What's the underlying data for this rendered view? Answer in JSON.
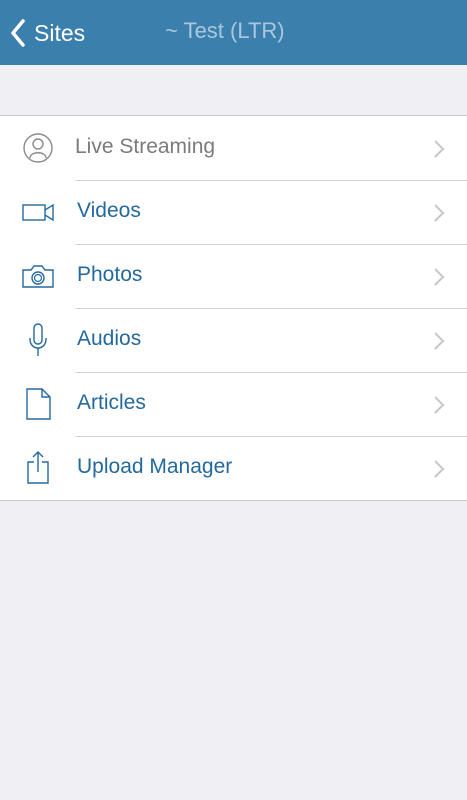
{
  "navbar": {
    "back_label": "Sites",
    "title": "~ Test (LTR)"
  },
  "menu": {
    "items": [
      {
        "label": "Live Streaming",
        "icon": "user-circle-icon"
      },
      {
        "label": "Videos",
        "icon": "video-camera-icon"
      },
      {
        "label": "Photos",
        "icon": "camera-icon"
      },
      {
        "label": "Audios",
        "icon": "microphone-icon"
      },
      {
        "label": "Articles",
        "icon": "document-icon"
      },
      {
        "label": "Upload Manager",
        "icon": "share-upload-icon"
      }
    ]
  },
  "colors": {
    "navbar_bg": "#3b7fad",
    "accent_text": "#2369a0",
    "disabled_text": "#7b7b7b",
    "background": "#efeff4"
  }
}
